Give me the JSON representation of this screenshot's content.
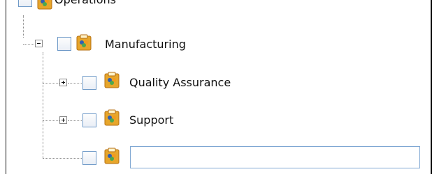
{
  "tree": {
    "nodes": [
      {
        "label": "Operations",
        "expanded": true,
        "checked": false
      },
      {
        "label": "Manufacturing",
        "expanded": true,
        "checked": false
      },
      {
        "label": "Quality Assurance",
        "expanded": false,
        "checked": false
      },
      {
        "label": "Support",
        "expanded": false,
        "checked": false
      },
      {
        "label": "",
        "checked": false,
        "editing": true,
        "input_value": ""
      }
    ],
    "icon": "org-unit-clipboard-icon",
    "colors": {
      "checkbox_border": "#6f9ac8",
      "edit_border": "#7fa7d3",
      "icon_clipboard": "#e7a62b",
      "icon_person_blue": "#2f5fb5",
      "icon_person_orange": "#f29b1e",
      "icon_person_green": "#4ea84c"
    }
  }
}
